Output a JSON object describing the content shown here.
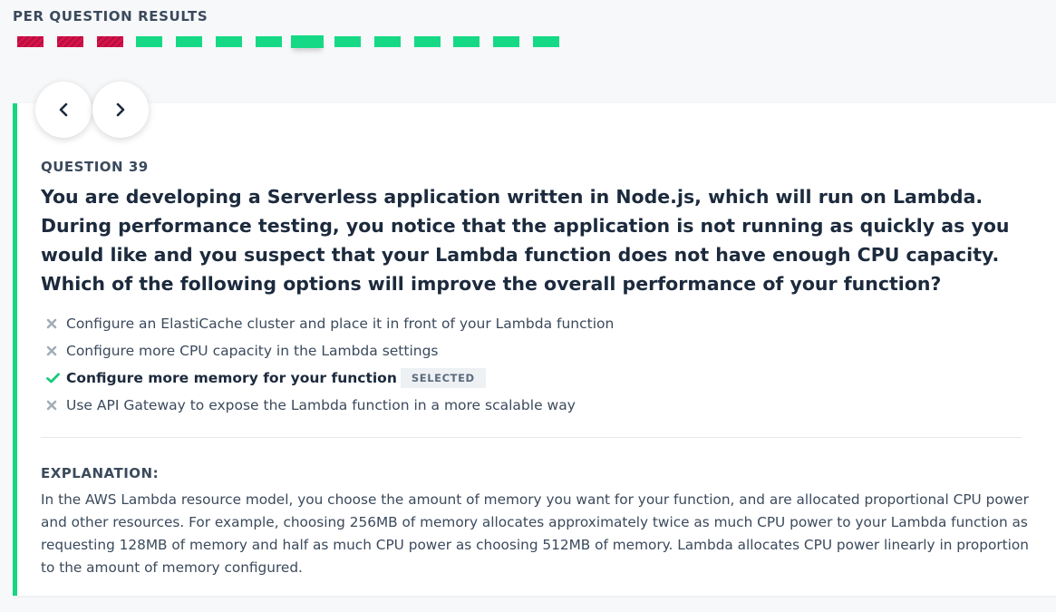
{
  "results": {
    "title": "PER QUESTION RESULTS",
    "bars": [
      {
        "status": "wrong"
      },
      {
        "status": "wrong"
      },
      {
        "status": "wrong"
      },
      {
        "status": "correct"
      },
      {
        "status": "correct"
      },
      {
        "status": "correct"
      },
      {
        "status": "correct"
      },
      {
        "status": "correct",
        "current": true
      },
      {
        "status": "correct"
      },
      {
        "status": "correct"
      },
      {
        "status": "correct"
      },
      {
        "status": "correct"
      },
      {
        "status": "correct"
      },
      {
        "status": "correct"
      }
    ],
    "colors": {
      "wrong": "#d9134c",
      "correct": "#16d985"
    }
  },
  "nav": {
    "prev_icon": "chevron-left-icon",
    "next_icon": "chevron-right-icon"
  },
  "question": {
    "label": "QUESTION 39",
    "text": "You are developing a Serverless application written in Node.js, which will run on Lambda. During performance testing, you notice that the application is not running as quickly as you would like and you suspect that your Lambda function does not have enough CPU capacity. Which of the following options will improve the overall performance of your function?",
    "answers": [
      {
        "text": "Configure an ElastiCache cluster and place it in front of your Lambda function",
        "icon": "x-icon"
      },
      {
        "text": "Configure more CPU capacity in the Lambda settings",
        "icon": "x-icon"
      },
      {
        "text": "Configure more memory for your function",
        "icon": "check-icon",
        "badge": "SELECTED"
      },
      {
        "text": "Use API Gateway to expose the Lambda function in a more scalable way",
        "icon": "x-icon"
      }
    ]
  },
  "explanation": {
    "label": "EXPLANATION:",
    "text": "In the AWS Lambda resource model, you choose the amount of memory you want for your function, and are allocated proportional CPU power and other resources. For example, choosing 256MB of memory allocates approximately twice as much CPU power to your Lambda function as requesting 128MB of memory and half as much CPU power as choosing 512MB of memory. Lambda allocates CPU power linearly in proportion to the amount of memory configured."
  },
  "accent_color": "#17d67f"
}
